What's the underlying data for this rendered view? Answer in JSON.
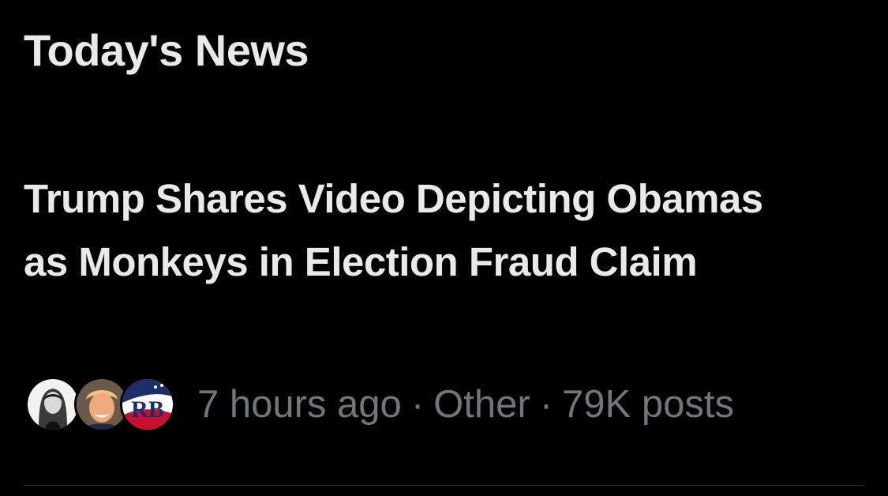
{
  "section": {
    "title": "Today's News"
  },
  "story": {
    "headline": "Trump Shares Video Depicting Obamas as Monkeys in Election Fraud Claim",
    "time": "7 hours ago",
    "category": "Other",
    "posts": "79K posts",
    "separator": "·",
    "avatars": [
      {
        "icon": "grayscale-portrait-avatar"
      },
      {
        "icon": "portrait-avatar"
      },
      {
        "icon": "rb-logo-avatar",
        "logo_text": "RB"
      }
    ]
  },
  "colors": {
    "background": "#000000",
    "primary_text": "#e7e9ea",
    "secondary_text": "#71767b",
    "divider": "#2f3336"
  }
}
